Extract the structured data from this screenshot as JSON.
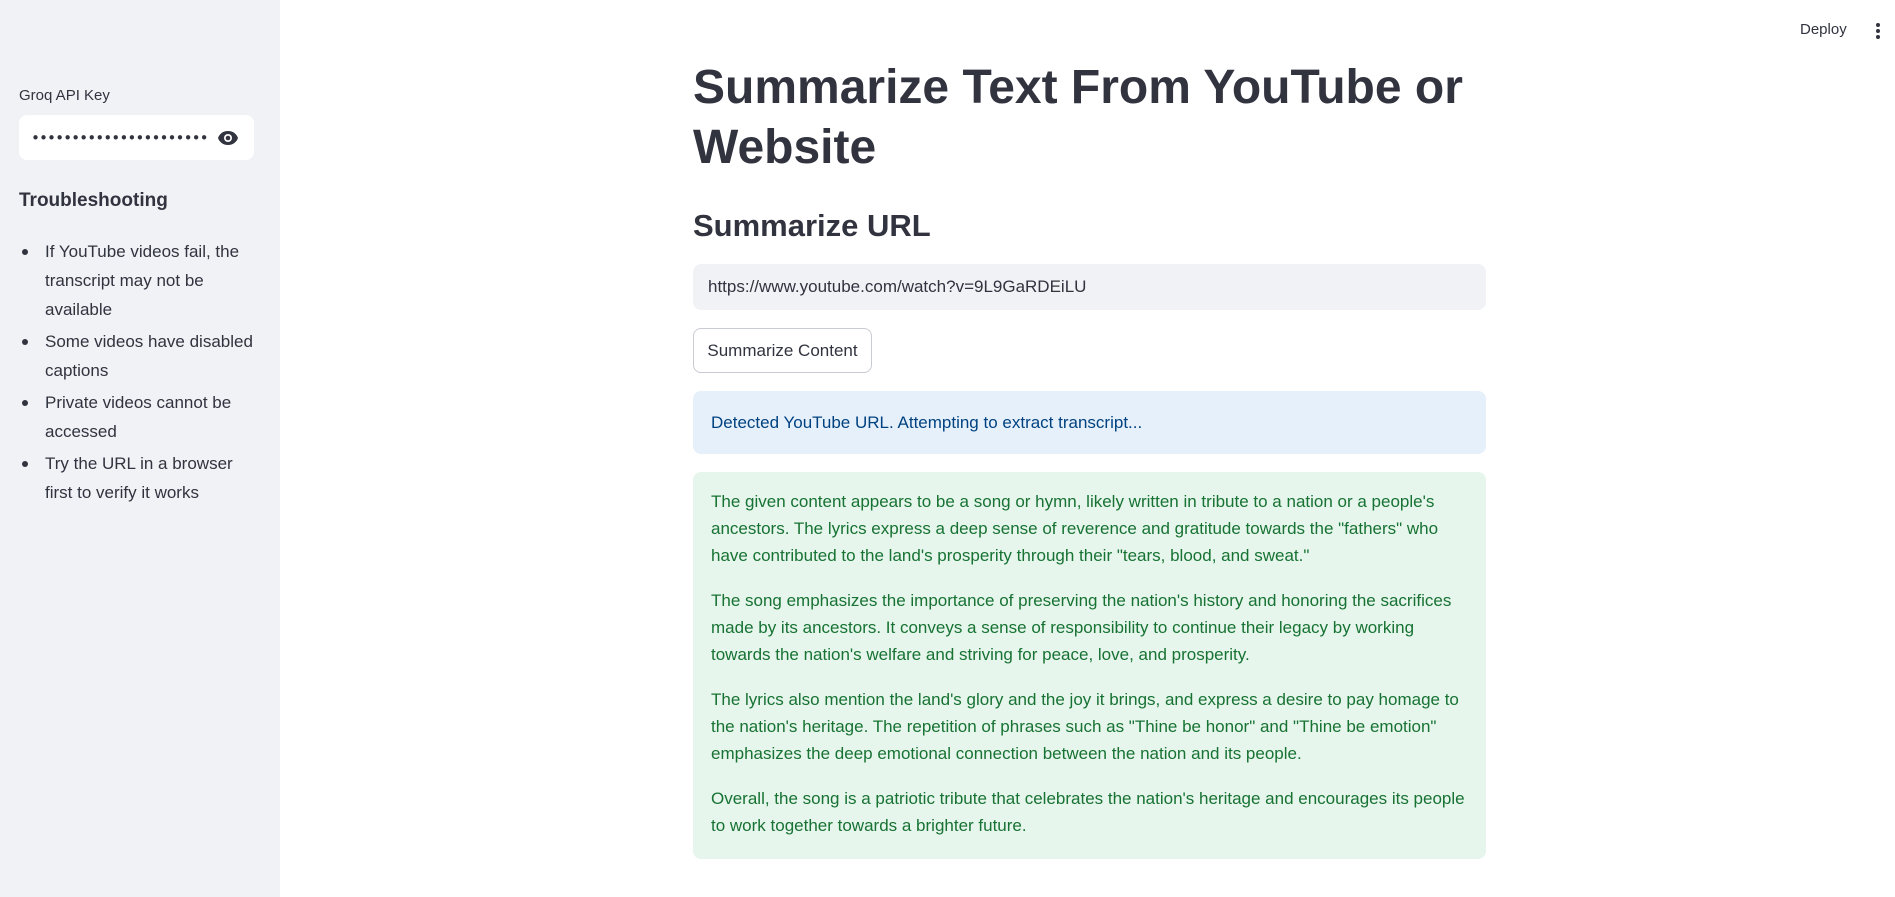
{
  "header": {
    "deploy_label": "Deploy",
    "menu_icon": "kebab-menu-icon"
  },
  "sidebar": {
    "api_key_label": "Groq API Key",
    "api_key_value": "••••••••••••••••••••••••••••••",
    "visibility_icon": "eye-icon",
    "troubleshooting_title": "Troubleshooting",
    "items": [
      "If YouTube videos fail, the transcript may not be available",
      "Some videos have disabled captions",
      "Private videos cannot be accessed",
      "Try the URL in a browser first to verify it works"
    ]
  },
  "main": {
    "title": "Summarize Text From YouTube or Website",
    "subtitle": "Summarize URL",
    "url_value": "https://www.youtube.com/watch?v=9L9GaRDEiLU",
    "button_label": "Summarize Content",
    "info_message": "Detected YouTube URL. Attempting to extract transcript...",
    "summary_paragraphs": [
      "The given content appears to be a song or hymn, likely written in tribute to a nation or a people's ancestors. The lyrics express a deep sense of reverence and gratitude towards the \"fathers\" who have contributed to the land's prosperity through their \"tears, blood, and sweat.\"",
      "The song emphasizes the importance of preserving the nation's history and honoring the sacrifices made by its ancestors. It conveys a sense of responsibility to continue their legacy by working towards the nation's welfare and striving for peace, love, and prosperity.",
      "The lyrics also mention the land's glory and the joy it brings, and express a desire to pay homage to the nation's heritage. The repetition of phrases such as \"Thine be honor\" and \"Thine be emotion\" emphasizes the deep emotional connection between the nation and its people.",
      "Overall, the song is a patriotic tribute that celebrates the nation's heritage and encourages its people to work together towards a brighter future."
    ]
  },
  "colors": {
    "sidebar_bg": "#f0f2f6",
    "text": "#31333f",
    "info_bg": "#e6f0fb",
    "info_text": "#004280",
    "success_bg": "#e6f6ec",
    "success_text": "#177233"
  }
}
